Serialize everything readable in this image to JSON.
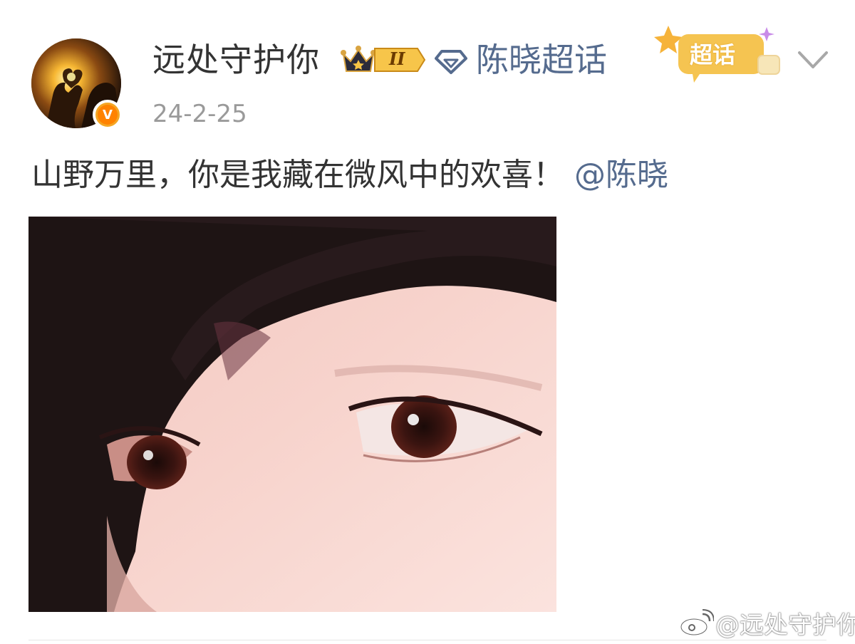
{
  "post": {
    "author": {
      "name": "远处守护你",
      "level_label": "II",
      "avatar": "avatar-heart-hands-sunset",
      "verified_icon": "v-badge-icon",
      "verified_label": "V"
    },
    "supertopic": {
      "name": "陈晓超话",
      "sticker_label": "超话",
      "icon": "diamond-icon"
    },
    "timestamp": "24-2-25",
    "text": {
      "body": "山野万里，你是我藏在微风中的欢喜！",
      "mention": "@陈晓"
    },
    "image": {
      "subject": "close-up-eyes-photo"
    },
    "watermark": {
      "icon": "weibo-icon",
      "text": "@远处守护你"
    }
  },
  "colors": {
    "username": "#333333",
    "link": "#556b8e",
    "timestamp": "#9a9a9a",
    "verified": "#ff8200",
    "sticker": "#f5c451"
  }
}
